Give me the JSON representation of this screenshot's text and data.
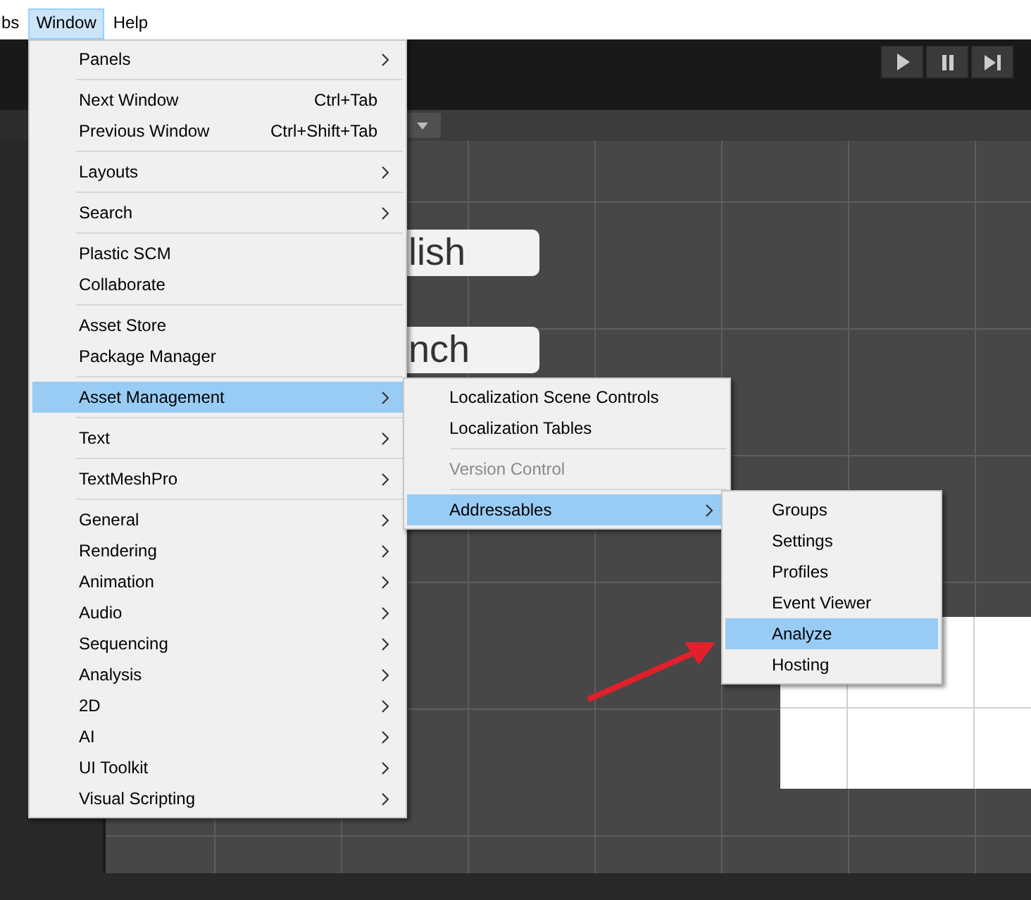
{
  "menubar": [
    {
      "label": "bs",
      "selected": false
    },
    {
      "label": "Window",
      "selected": true
    },
    {
      "label": "Help",
      "selected": false
    }
  ],
  "scene": {
    "labels": [
      "lish",
      "nch"
    ]
  },
  "window_menu": [
    {
      "kind": "item",
      "label": "Panels",
      "submenu": true,
      "selected": false,
      "disabled": false
    },
    {
      "kind": "separator"
    },
    {
      "kind": "item",
      "label": "Next Window",
      "shortcut": "Ctrl+Tab",
      "submenu": false,
      "selected": false,
      "disabled": false
    },
    {
      "kind": "item",
      "label": "Previous Window",
      "shortcut": "Ctrl+Shift+Tab",
      "submenu": false,
      "selected": false,
      "disabled": false
    },
    {
      "kind": "separator"
    },
    {
      "kind": "item",
      "label": "Layouts",
      "submenu": true,
      "selected": false,
      "disabled": false
    },
    {
      "kind": "separator"
    },
    {
      "kind": "item",
      "label": "Search",
      "submenu": true,
      "selected": false,
      "disabled": false
    },
    {
      "kind": "separator"
    },
    {
      "kind": "item",
      "label": "Plastic SCM",
      "submenu": false,
      "selected": false,
      "disabled": false
    },
    {
      "kind": "item",
      "label": "Collaborate",
      "submenu": false,
      "selected": false,
      "disabled": false
    },
    {
      "kind": "separator"
    },
    {
      "kind": "item",
      "label": "Asset Store",
      "submenu": false,
      "selected": false,
      "disabled": false
    },
    {
      "kind": "item",
      "label": "Package Manager",
      "submenu": false,
      "selected": false,
      "disabled": false
    },
    {
      "kind": "separator"
    },
    {
      "kind": "item",
      "label": "Asset Management",
      "submenu": true,
      "selected": true,
      "disabled": false
    },
    {
      "kind": "separator"
    },
    {
      "kind": "item",
      "label": "Text",
      "submenu": true,
      "selected": false,
      "disabled": false
    },
    {
      "kind": "separator"
    },
    {
      "kind": "item",
      "label": "TextMeshPro",
      "submenu": true,
      "selected": false,
      "disabled": false
    },
    {
      "kind": "separator"
    },
    {
      "kind": "item",
      "label": "General",
      "submenu": true,
      "selected": false,
      "disabled": false
    },
    {
      "kind": "item",
      "label": "Rendering",
      "submenu": true,
      "selected": false,
      "disabled": false
    },
    {
      "kind": "item",
      "label": "Animation",
      "submenu": true,
      "selected": false,
      "disabled": false
    },
    {
      "kind": "item",
      "label": "Audio",
      "submenu": true,
      "selected": false,
      "disabled": false
    },
    {
      "kind": "item",
      "label": "Sequencing",
      "submenu": true,
      "selected": false,
      "disabled": false
    },
    {
      "kind": "item",
      "label": "Analysis",
      "submenu": true,
      "selected": false,
      "disabled": false
    },
    {
      "kind": "item",
      "label": "2D",
      "submenu": true,
      "selected": false,
      "disabled": false
    },
    {
      "kind": "item",
      "label": "AI",
      "submenu": true,
      "selected": false,
      "disabled": false
    },
    {
      "kind": "item",
      "label": "UI Toolkit",
      "submenu": true,
      "selected": false,
      "disabled": false
    },
    {
      "kind": "item",
      "label": "Visual Scripting",
      "submenu": true,
      "selected": false,
      "disabled": false
    }
  ],
  "asset_management_menu": [
    {
      "kind": "item",
      "label": "Localization Scene Controls",
      "submenu": false,
      "selected": false,
      "disabled": false
    },
    {
      "kind": "item",
      "label": "Localization Tables",
      "submenu": false,
      "selected": false,
      "disabled": false
    },
    {
      "kind": "separator"
    },
    {
      "kind": "item",
      "label": "Version Control",
      "submenu": false,
      "selected": false,
      "disabled": true
    },
    {
      "kind": "separator"
    },
    {
      "kind": "item",
      "label": "Addressables",
      "submenu": true,
      "selected": true,
      "disabled": false
    }
  ],
  "addressables_menu": [
    {
      "kind": "item",
      "label": "Groups",
      "submenu": false,
      "selected": false,
      "disabled": false
    },
    {
      "kind": "item",
      "label": "Settings",
      "submenu": false,
      "selected": false,
      "disabled": false
    },
    {
      "kind": "item",
      "label": "Profiles",
      "submenu": false,
      "selected": false,
      "disabled": false
    },
    {
      "kind": "item",
      "label": "Event Viewer",
      "submenu": false,
      "selected": false,
      "disabled": false
    },
    {
      "kind": "item",
      "label": "Analyze",
      "submenu": false,
      "selected": true,
      "disabled": false
    },
    {
      "kind": "item",
      "label": "Hosting",
      "submenu": false,
      "selected": false,
      "disabled": false
    }
  ]
}
